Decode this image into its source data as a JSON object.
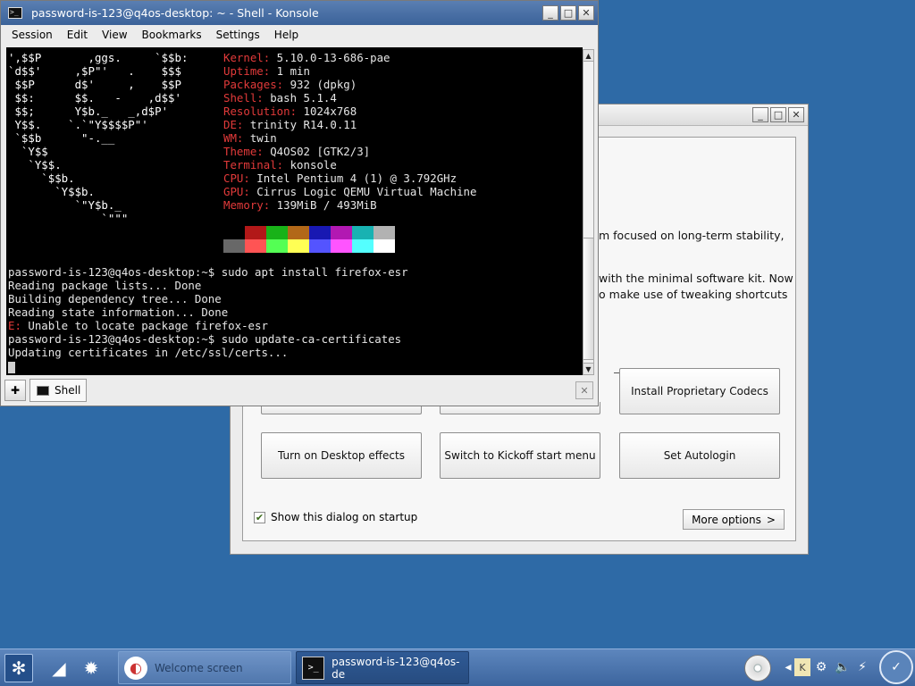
{
  "welcome": {
    "title_buttons": [
      "_",
      "□",
      "✕"
    ],
    "paragraph_fragments": [
      "m focused on long-term stability,",
      "with the minimal software kit. Now",
      "o make use of tweaking shortcuts"
    ],
    "buttons": {
      "codecs": "Install Proprietary Codecs",
      "desktop_effects": "Turn on Desktop effects",
      "kickoff": "Switch to Kickoff start menu",
      "autologin": "Set Autologin"
    },
    "show_on_startup_label": "Show this dialog on startup",
    "show_on_startup_checked": true,
    "more_options_label": "More options",
    "more_options_arrow": ">"
  },
  "konsole": {
    "title": "password-is-123@q4os-desktop: ~ - Shell - Konsole",
    "menu": [
      "Session",
      "Edit",
      "View",
      "Bookmarks",
      "Settings",
      "Help"
    ],
    "logo_lines": [
      "',$$P       ,ggs.     `$$b:",
      "`d$$'     ,$P\"'   .    $$$",
      " $$P      d$'     ,    $$P",
      " $$:      $$.   -    ,d$$'",
      " $$;      Y$b._   _,d$P'",
      " Y$$.    `.`\"Y$$$$P\"'",
      " `$$b      \"-.__",
      "  `Y$$",
      "   `Y$$.",
      "     `$$b.",
      "       `Y$$b.",
      "          `\"Y$b._",
      "              `\"\"\""
    ],
    "sysinfo": [
      {
        "key": "Kernel",
        "value": "5.10.0-13-686-pae"
      },
      {
        "key": "Uptime",
        "value": "1 min"
      },
      {
        "key": "Packages",
        "value": "932 (dpkg)"
      },
      {
        "key": "Shell",
        "value": "bash 5.1.4"
      },
      {
        "key": "Resolution",
        "value": "1024x768"
      },
      {
        "key": "DE",
        "value": "trinity R14.0.11"
      },
      {
        "key": "WM",
        "value": "twin"
      },
      {
        "key": "Theme",
        "value": "Q4OS02 [GTK2/3]"
      },
      {
        "key": "Terminal",
        "value": "konsole"
      },
      {
        "key": "CPU",
        "value": "Intel Pentium 4 (1) @ 3.792GHz"
      },
      {
        "key": "GPU",
        "value": "Cirrus Logic QEMU Virtual Machine"
      },
      {
        "key": "Memory",
        "value": "139MiB / 493MiB"
      }
    ],
    "palette_top": [
      "#000000",
      "#b21818",
      "#18b218",
      "#b26818",
      "#1818b2",
      "#b218b2",
      "#18b2b2",
      "#b2b2b2"
    ],
    "palette_bottom": [
      "#686868",
      "#ff5454",
      "#54ff54",
      "#ffff54",
      "#5454ff",
      "#ff54ff",
      "#54ffff",
      "#ffffff"
    ],
    "prompt1": "password-is-123@q4os-desktop:~$ sudo apt install firefox-esr",
    "out1": "Reading package lists... Done",
    "out2": "Building dependency tree... Done",
    "out3": "Reading state information... Done",
    "err_prefix": "E:",
    "err_text": " Unable to locate package firefox-esr",
    "prompt2": "password-is-123@q4os-desktop:~$ sudo update-ca-certificates",
    "out4": "Updating certificates in /etc/ssl/certs...",
    "tab_label": "Shell"
  },
  "taskbar": {
    "items": [
      {
        "label": "Welcome screen"
      },
      {
        "label": "password-is-123@q4os-de"
      }
    ]
  },
  "colors": {
    "desktop": "#2e6aa6",
    "titlebar_active": "#4a71a8",
    "terminal_bg": "#000000",
    "terminal_key": "#e23a3a"
  }
}
